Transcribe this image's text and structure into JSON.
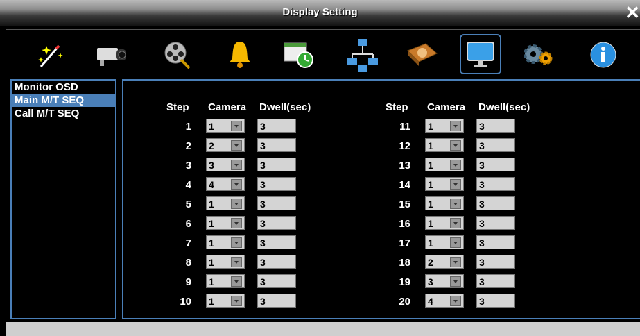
{
  "window": {
    "title": "Display Setting"
  },
  "toolbar": {
    "icons": [
      "wizard-icon",
      "camera-icon",
      "film-reel-icon",
      "bell-icon",
      "schedule-icon",
      "network-icon",
      "hdd-icon",
      "monitor-icon",
      "settings-icon",
      "info-icon"
    ],
    "selected": "monitor-icon",
    "accent": "#4a7fb8"
  },
  "sidebar": {
    "items": [
      {
        "label": "Monitor OSD"
      },
      {
        "label": "Main M/T SEQ"
      },
      {
        "label": "Call M/T SEQ"
      }
    ],
    "active": "Main M/T SEQ"
  },
  "table": {
    "headers": {
      "step": "Step",
      "camera": "Camera",
      "dwell": "Dwell(sec)"
    },
    "left": [
      {
        "step": "1",
        "camera": "1",
        "dwell": "3"
      },
      {
        "step": "2",
        "camera": "2",
        "dwell": "3"
      },
      {
        "step": "3",
        "camera": "3",
        "dwell": "3"
      },
      {
        "step": "4",
        "camera": "4",
        "dwell": "3"
      },
      {
        "step": "5",
        "camera": "1",
        "dwell": "3"
      },
      {
        "step": "6",
        "camera": "1",
        "dwell": "3"
      },
      {
        "step": "7",
        "camera": "1",
        "dwell": "3"
      },
      {
        "step": "8",
        "camera": "1",
        "dwell": "3"
      },
      {
        "step": "9",
        "camera": "1",
        "dwell": "3"
      },
      {
        "step": "10",
        "camera": "1",
        "dwell": "3"
      }
    ],
    "right": [
      {
        "step": "11",
        "camera": "1",
        "dwell": "3"
      },
      {
        "step": "12",
        "camera": "1",
        "dwell": "3"
      },
      {
        "step": "13",
        "camera": "1",
        "dwell": "3"
      },
      {
        "step": "14",
        "camera": "1",
        "dwell": "3"
      },
      {
        "step": "15",
        "camera": "1",
        "dwell": "3"
      },
      {
        "step": "16",
        "camera": "1",
        "dwell": "3"
      },
      {
        "step": "17",
        "camera": "1",
        "dwell": "3"
      },
      {
        "step": "18",
        "camera": "2",
        "dwell": "3"
      },
      {
        "step": "19",
        "camera": "3",
        "dwell": "3"
      },
      {
        "step": "20",
        "camera": "4",
        "dwell": "3"
      }
    ]
  }
}
